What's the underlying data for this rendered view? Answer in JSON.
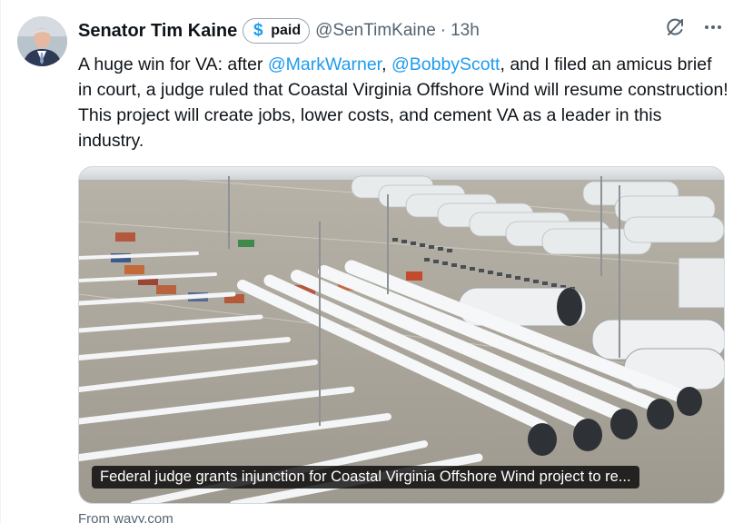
{
  "author": {
    "name": "Senator Tim Kaine",
    "badge_label": "paid",
    "badge_icon": "dollar-sign-icon",
    "handle": "@SenTimKaine",
    "separator": "·",
    "time": "13h"
  },
  "tweet": {
    "text_1": "A huge win for VA: after ",
    "mention_1": "@MarkWarner",
    "text_2": ", ",
    "mention_2": "@BobbyScott",
    "text_3": ", and I filed an amicus brief in court, a judge ruled that Coastal Virginia Offshore Wind will resume construction! This project will create jobs, lower costs, and cement VA as a leader in this industry."
  },
  "card": {
    "caption": "Federal judge grants injunction for Coastal Virginia Offshore Wind project to re...",
    "source": "From wavy.com"
  },
  "icons": {
    "grok": "grok-icon",
    "more": "more-icon"
  },
  "colors": {
    "accent": "#1d9bf0",
    "secondary_text": "#536471"
  }
}
